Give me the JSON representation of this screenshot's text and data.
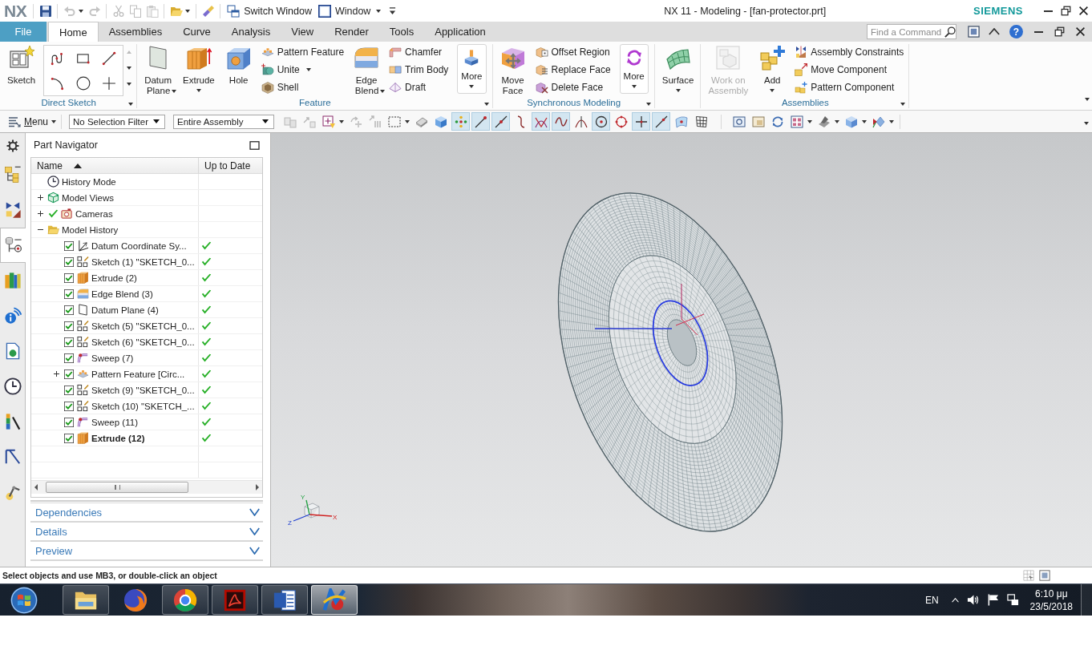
{
  "title_bar": {
    "logo": "NX",
    "quick_access": [
      [
        {
          "kind": "save",
          "disabled": false,
          "dropdown": false
        }
      ],
      [
        {
          "kind": "undo",
          "disabled": true,
          "dropdown": true
        },
        {
          "kind": "redo",
          "disabled": true,
          "dropdown": false
        }
      ],
      [
        {
          "kind": "cut",
          "disabled": true,
          "dropdown": false
        },
        {
          "kind": "copy",
          "disabled": true,
          "dropdown": false
        },
        {
          "kind": "paste",
          "disabled": true,
          "dropdown": false
        }
      ],
      [
        {
          "kind": "open",
          "disabled": false,
          "dropdown": true
        }
      ],
      [
        {
          "kind": "brush",
          "disabled": false,
          "dropdown": false
        }
      ]
    ],
    "switch_window": "Switch Window",
    "window_menu": "Window",
    "title": "NX 11 - Modeling - [fan-protector.prt]",
    "brand": "SIEMENS"
  },
  "ribbon_bar": {
    "tabs": [
      {
        "label": "File",
        "kind": "file",
        "selected": false
      },
      {
        "label": "Home",
        "kind": "tab",
        "selected": true
      },
      {
        "label": "Assemblies",
        "kind": "tab",
        "selected": false
      },
      {
        "label": "Curve",
        "kind": "tab",
        "selected": false
      },
      {
        "label": "Analysis",
        "kind": "tab",
        "selected": false
      },
      {
        "label": "View",
        "kind": "tab",
        "selected": false
      },
      {
        "label": "Render",
        "kind": "tab",
        "selected": false
      },
      {
        "label": "Tools",
        "kind": "tab",
        "selected": false
      },
      {
        "label": "Application",
        "kind": "tab",
        "selected": false
      }
    ],
    "command_finder": {
      "placeholder": "Find a Command"
    },
    "help": "?"
  },
  "ribbon": {
    "groups": [
      {
        "label": "Direct Sketch",
        "launcher": true,
        "items": [
          {
            "kind": "button",
            "label": "Sketch",
            "dropdown": false
          },
          {
            "kind": "gallery"
          }
        ]
      },
      {
        "label": "Feature",
        "launcher": true,
        "items": [
          {
            "kind": "button",
            "label": "Datum Plane",
            "dropdown": true
          },
          {
            "kind": "button",
            "label": "Extrude",
            "dropdown": true
          },
          {
            "kind": "button",
            "label": "Hole",
            "dropdown": false
          },
          {
            "kind": "stack",
            "commands": [
              {
                "label": "Pattern Feature",
                "dropdown": false
              },
              {
                "label": "Unite",
                "dropdown": true
              },
              {
                "label": "Shell",
                "dropdown": false
              }
            ]
          },
          {
            "kind": "button",
            "label": "Edge Blend",
            "dropdown": true
          },
          {
            "kind": "stack",
            "commands": [
              {
                "label": "Chamfer",
                "dropdown": false
              },
              {
                "label": "Trim Body",
                "dropdown": false
              },
              {
                "label": "Draft",
                "dropdown": false
              }
            ]
          },
          {
            "kind": "more",
            "label": "More",
            "dropdown": true
          }
        ]
      },
      {
        "label": "Synchronous Modeling",
        "launcher": true,
        "items": [
          {
            "kind": "button",
            "label": "Move Face",
            "dropdown": false
          },
          {
            "kind": "stack",
            "commands": [
              {
                "label": "Offset Region",
                "dropdown": false
              },
              {
                "label": "Replace Face",
                "dropdown": false
              },
              {
                "label": "Delete Face",
                "dropdown": false
              }
            ]
          },
          {
            "kind": "more",
            "label": "More",
            "dropdown": true
          }
        ]
      },
      {
        "launcher": false,
        "items": [
          {
            "kind": "button",
            "label": "Surface",
            "dropdown": true
          }
        ]
      },
      {
        "label": "Assemblies",
        "launcher": true,
        "items": [
          {
            "kind": "button",
            "label": "Work on Assembly",
            "dropdown": false,
            "disabled": true
          },
          {
            "kind": "button",
            "label": "Add",
            "dropdown": true,
            "disabled": false
          },
          {
            "kind": "stack",
            "commands": [
              {
                "label": "Assembly Constraints",
                "dropdown": false
              },
              {
                "label": "Move Component",
                "dropdown": false
              },
              {
                "label": "Pattern Component",
                "dropdown": false
              }
            ]
          }
        ]
      }
    ]
  },
  "toolbar": {
    "menu": "Menu",
    "selection_filter": "No Selection Filter",
    "scope": "Entire Assembly",
    "selection_tools": [
      {
        "disabled": true,
        "dropdown": false
      },
      {
        "disabled": true,
        "dropdown": false
      },
      {
        "disabled": false,
        "dropdown": true
      },
      {
        "disabled": true,
        "dropdown": false
      },
      {
        "disabled": true,
        "dropdown": false
      },
      {
        "disabled": false,
        "dropdown": true
      },
      {
        "disabled": false,
        "dropdown": false
      },
      {
        "disabled": false,
        "dropdown": false
      }
    ],
    "snap_points": [
      {
        "kind": "grid",
        "on": true
      },
      {
        "kind": "end",
        "on": true
      },
      {
        "kind": "mid",
        "on": true
      },
      {
        "kind": "control",
        "on": false
      },
      {
        "kind": "intersection",
        "on": true
      },
      {
        "kind": "spline",
        "on": true
      },
      {
        "kind": "tangent",
        "on": false
      },
      {
        "kind": "center",
        "on": true
      },
      {
        "kind": "quadrant",
        "on": false
      },
      {
        "kind": "existing",
        "on": true
      },
      {
        "kind": "curve",
        "on": true
      },
      {
        "kind": "surface",
        "on": false
      },
      {
        "kind": "pole",
        "on": false
      }
    ],
    "view_tools": [
      {
        "dropdown": false
      },
      {
        "dropdown": false
      },
      {
        "dropdown": false
      },
      {
        "dropdown": true
      },
      {
        "dropdown": true
      },
      {
        "dropdown": true
      },
      {
        "dropdown": true
      }
    ]
  },
  "resource_bar": [
    {
      "kind": "settings",
      "selected": false
    },
    {
      "kind": "assemblies",
      "selected": false
    },
    {
      "kind": "constraints",
      "selected": false
    },
    {
      "kind": "parts",
      "selected": true
    },
    {
      "kind": "library",
      "selected": false
    },
    {
      "kind": "info",
      "selected": false
    },
    {
      "kind": "browser",
      "selected": false
    },
    {
      "kind": "history",
      "selected": false
    },
    {
      "kind": "materials",
      "selected": false
    },
    {
      "kind": "process",
      "selected": false
    },
    {
      "kind": "roles",
      "selected": false
    }
  ],
  "part_navigator": {
    "title": "Part Navigator",
    "columns": [
      {
        "label": "Name",
        "sorted": true
      },
      {
        "label": "Up to Date",
        "sorted": false
      }
    ],
    "tree": [
      {
        "label": "History Mode",
        "kind": "history",
        "ticked": false
      },
      {
        "label": "Model Views",
        "kind": "views",
        "ticked": false,
        "expanded": false
      },
      {
        "label": "Cameras",
        "kind": "cameras",
        "ticked": true,
        "expanded": false
      },
      {
        "label": "Model History",
        "kind": "folder",
        "ticked": false,
        "expanded": true,
        "children": [
          {
            "label": "Datum Coordinate Sy...",
            "kind": "csys",
            "checked": true,
            "up_to_date": true,
            "current": false
          },
          {
            "label": "Sketch (1) \"SKETCH_0...",
            "kind": "sketch",
            "checked": true,
            "up_to_date": true,
            "current": false
          },
          {
            "label": "Extrude (2)",
            "kind": "extrude",
            "checked": true,
            "up_to_date": true,
            "current": false
          },
          {
            "label": "Edge Blend (3)",
            "kind": "blend",
            "checked": true,
            "up_to_date": true,
            "current": false
          },
          {
            "label": "Datum Plane (4)",
            "kind": "plane",
            "checked": true,
            "up_to_date": true,
            "current": false
          },
          {
            "label": "Sketch (5) \"SKETCH_0...",
            "kind": "sketch",
            "checked": true,
            "up_to_date": true,
            "current": false
          },
          {
            "label": "Sketch (6) \"SKETCH_0...",
            "kind": "sketch",
            "checked": true,
            "up_to_date": true,
            "current": false
          },
          {
            "label": "Sweep (7)",
            "kind": "sweep",
            "checked": true,
            "up_to_date": true,
            "current": false
          },
          {
            "label": "Pattern Feature [Circ...",
            "kind": "pattern",
            "checked": true,
            "up_to_date": true,
            "current": false,
            "expanded": false
          },
          {
            "label": "Sketch (9) \"SKETCH_0...",
            "kind": "sketch",
            "checked": true,
            "up_to_date": true,
            "current": false
          },
          {
            "label": "Sketch (10) \"SKETCH_...",
            "kind": "sketch",
            "checked": true,
            "up_to_date": true,
            "current": false
          },
          {
            "label": "Sweep (11)",
            "kind": "sweep",
            "checked": true,
            "up_to_date": true,
            "current": false
          },
          {
            "label": "Extrude (12)",
            "kind": "extrude",
            "checked": true,
            "up_to_date": true,
            "current": true
          }
        ]
      }
    ],
    "panels": [
      {
        "label": "Dependencies",
        "expanded": false
      },
      {
        "label": "Details",
        "expanded": false
      },
      {
        "label": "Preview",
        "expanded": false
      }
    ]
  },
  "viewport": {
    "triad": {
      "x": "X",
      "y": "Y",
      "z": "Z"
    }
  },
  "status_bar": {
    "message": "Select objects and use MB3, or double-click an object"
  },
  "taskbar": {
    "apps": [
      {
        "kind": "explorer",
        "running": true,
        "selected": false
      },
      {
        "kind": "firefox",
        "running": false,
        "selected": false
      },
      {
        "kind": "chrome",
        "running": true,
        "selected": false
      },
      {
        "kind": "acrobat",
        "running": true,
        "selected": false
      },
      {
        "kind": "word",
        "running": true,
        "selected": false
      },
      {
        "kind": "nx",
        "running": true,
        "selected": true
      }
    ],
    "language": "EN",
    "time": "6:10 μμ",
    "date": "23/5/2018"
  }
}
